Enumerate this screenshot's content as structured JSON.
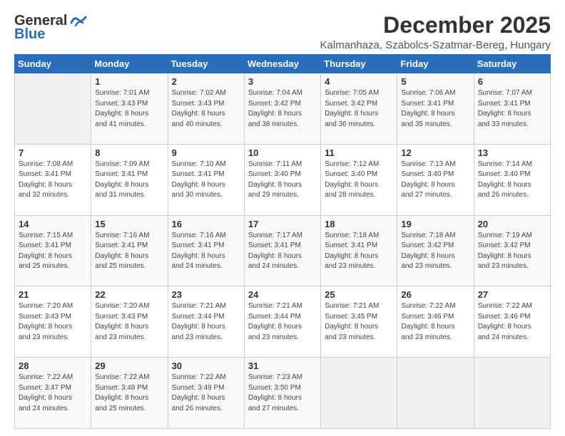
{
  "logo": {
    "general": "General",
    "blue": "Blue"
  },
  "header": {
    "month": "December 2025",
    "location": "Kalmanhaza, Szabolcs-Szatmar-Bereg, Hungary"
  },
  "weekdays": [
    "Sunday",
    "Monday",
    "Tuesday",
    "Wednesday",
    "Thursday",
    "Friday",
    "Saturday"
  ],
  "weeks": [
    [
      {
        "day": "",
        "info": ""
      },
      {
        "day": "1",
        "info": "Sunrise: 7:01 AM\nSunset: 3:43 PM\nDaylight: 8 hours\nand 41 minutes."
      },
      {
        "day": "2",
        "info": "Sunrise: 7:02 AM\nSunset: 3:43 PM\nDaylight: 8 hours\nand 40 minutes."
      },
      {
        "day": "3",
        "info": "Sunrise: 7:04 AM\nSunset: 3:42 PM\nDaylight: 8 hours\nand 38 minutes."
      },
      {
        "day": "4",
        "info": "Sunrise: 7:05 AM\nSunset: 3:42 PM\nDaylight: 8 hours\nand 36 minutes."
      },
      {
        "day": "5",
        "info": "Sunrise: 7:06 AM\nSunset: 3:41 PM\nDaylight: 8 hours\nand 35 minutes."
      },
      {
        "day": "6",
        "info": "Sunrise: 7:07 AM\nSunset: 3:41 PM\nDaylight: 8 hours\nand 33 minutes."
      }
    ],
    [
      {
        "day": "7",
        "info": "Sunrise: 7:08 AM\nSunset: 3:41 PM\nDaylight: 8 hours\nand 32 minutes."
      },
      {
        "day": "8",
        "info": "Sunrise: 7:09 AM\nSunset: 3:41 PM\nDaylight: 8 hours\nand 31 minutes."
      },
      {
        "day": "9",
        "info": "Sunrise: 7:10 AM\nSunset: 3:41 PM\nDaylight: 8 hours\nand 30 minutes."
      },
      {
        "day": "10",
        "info": "Sunrise: 7:11 AM\nSunset: 3:40 PM\nDaylight: 8 hours\nand 29 minutes."
      },
      {
        "day": "11",
        "info": "Sunrise: 7:12 AM\nSunset: 3:40 PM\nDaylight: 8 hours\nand 28 minutes."
      },
      {
        "day": "12",
        "info": "Sunrise: 7:13 AM\nSunset: 3:40 PM\nDaylight: 8 hours\nand 27 minutes."
      },
      {
        "day": "13",
        "info": "Sunrise: 7:14 AM\nSunset: 3:40 PM\nDaylight: 8 hours\nand 26 minutes."
      }
    ],
    [
      {
        "day": "14",
        "info": "Sunrise: 7:15 AM\nSunset: 3:41 PM\nDaylight: 8 hours\nand 25 minutes."
      },
      {
        "day": "15",
        "info": "Sunrise: 7:16 AM\nSunset: 3:41 PM\nDaylight: 8 hours\nand 25 minutes."
      },
      {
        "day": "16",
        "info": "Sunrise: 7:16 AM\nSunset: 3:41 PM\nDaylight: 8 hours\nand 24 minutes."
      },
      {
        "day": "17",
        "info": "Sunrise: 7:17 AM\nSunset: 3:41 PM\nDaylight: 8 hours\nand 24 minutes."
      },
      {
        "day": "18",
        "info": "Sunrise: 7:18 AM\nSunset: 3:41 PM\nDaylight: 8 hours\nand 23 minutes."
      },
      {
        "day": "19",
        "info": "Sunrise: 7:18 AM\nSunset: 3:42 PM\nDaylight: 8 hours\nand 23 minutes."
      },
      {
        "day": "20",
        "info": "Sunrise: 7:19 AM\nSunset: 3:42 PM\nDaylight: 8 hours\nand 23 minutes."
      }
    ],
    [
      {
        "day": "21",
        "info": "Sunrise: 7:20 AM\nSunset: 3:43 PM\nDaylight: 8 hours\nand 23 minutes."
      },
      {
        "day": "22",
        "info": "Sunrise: 7:20 AM\nSunset: 3:43 PM\nDaylight: 8 hours\nand 23 minutes."
      },
      {
        "day": "23",
        "info": "Sunrise: 7:21 AM\nSunset: 3:44 PM\nDaylight: 8 hours\nand 23 minutes."
      },
      {
        "day": "24",
        "info": "Sunrise: 7:21 AM\nSunset: 3:44 PM\nDaylight: 8 hours\nand 23 minutes."
      },
      {
        "day": "25",
        "info": "Sunrise: 7:21 AM\nSunset: 3:45 PM\nDaylight: 8 hours\nand 23 minutes."
      },
      {
        "day": "26",
        "info": "Sunrise: 7:22 AM\nSunset: 3:46 PM\nDaylight: 8 hours\nand 23 minutes."
      },
      {
        "day": "27",
        "info": "Sunrise: 7:22 AM\nSunset: 3:46 PM\nDaylight: 8 hours\nand 24 minutes."
      }
    ],
    [
      {
        "day": "28",
        "info": "Sunrise: 7:22 AM\nSunset: 3:47 PM\nDaylight: 8 hours\nand 24 minutes."
      },
      {
        "day": "29",
        "info": "Sunrise: 7:22 AM\nSunset: 3:48 PM\nDaylight: 8 hours\nand 25 minutes."
      },
      {
        "day": "30",
        "info": "Sunrise: 7:22 AM\nSunset: 3:49 PM\nDaylight: 8 hours\nand 26 minutes."
      },
      {
        "day": "31",
        "info": "Sunrise: 7:23 AM\nSunset: 3:50 PM\nDaylight: 8 hours\nand 27 minutes."
      },
      {
        "day": "",
        "info": ""
      },
      {
        "day": "",
        "info": ""
      },
      {
        "day": "",
        "info": ""
      }
    ]
  ]
}
